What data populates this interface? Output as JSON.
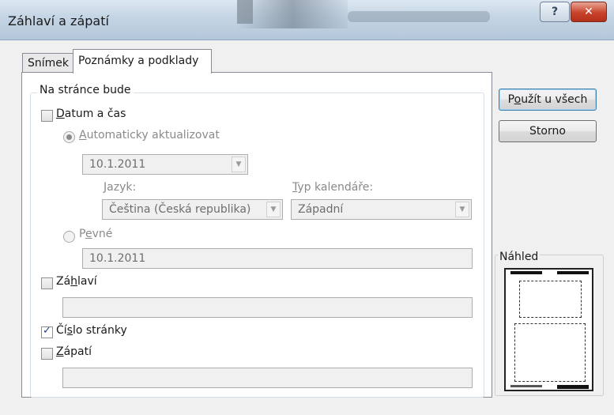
{
  "window": {
    "title": "Záhlaví a zápatí",
    "help_glyph": "?",
    "close_glyph": "✕"
  },
  "tabs": [
    {
      "label": "Snímek",
      "active": false
    },
    {
      "label": "Poznámky a podklady",
      "active": true
    }
  ],
  "group": {
    "label": "Na stránce bude",
    "datetime": {
      "checked": false,
      "label_u": "D",
      "label_rest": "atum a čas",
      "auto": {
        "selected": true,
        "label_u": "A",
        "label_rest": "utomaticky aktualizovat",
        "date_value": "10.1.2011"
      },
      "language": {
        "label_u": "J",
        "label_rest": "azyk:",
        "value": "Čeština (Česká republika)"
      },
      "calendar": {
        "label_u": "T",
        "label_rest": "yp kalendáře:",
        "value": "Západní"
      },
      "fixed": {
        "selected": false,
        "label_pre": "P",
        "label_u": "e",
        "label_rest": "vné",
        "value": "10.1.2011"
      }
    },
    "header": {
      "checked": false,
      "label_pre": "Zá",
      "label_u": "h",
      "label_rest": "laví",
      "value": ""
    },
    "slide_number": {
      "checked": true,
      "label_pre": "Čí",
      "label_u": "s",
      "label_rest": "lo stránky"
    },
    "footer": {
      "checked": false,
      "label_u": "Z",
      "label_rest": "ápatí",
      "value": ""
    }
  },
  "buttons": {
    "apply_all_pre": "P",
    "apply_all_u": "o",
    "apply_all_rest": "užít u všech",
    "cancel": "Storno"
  },
  "preview": {
    "label": "Náhled"
  },
  "colors": {
    "title_bar": "#c4d4e4",
    "close_button": "#c8432b",
    "default_button_border": "#3c7fb1"
  }
}
